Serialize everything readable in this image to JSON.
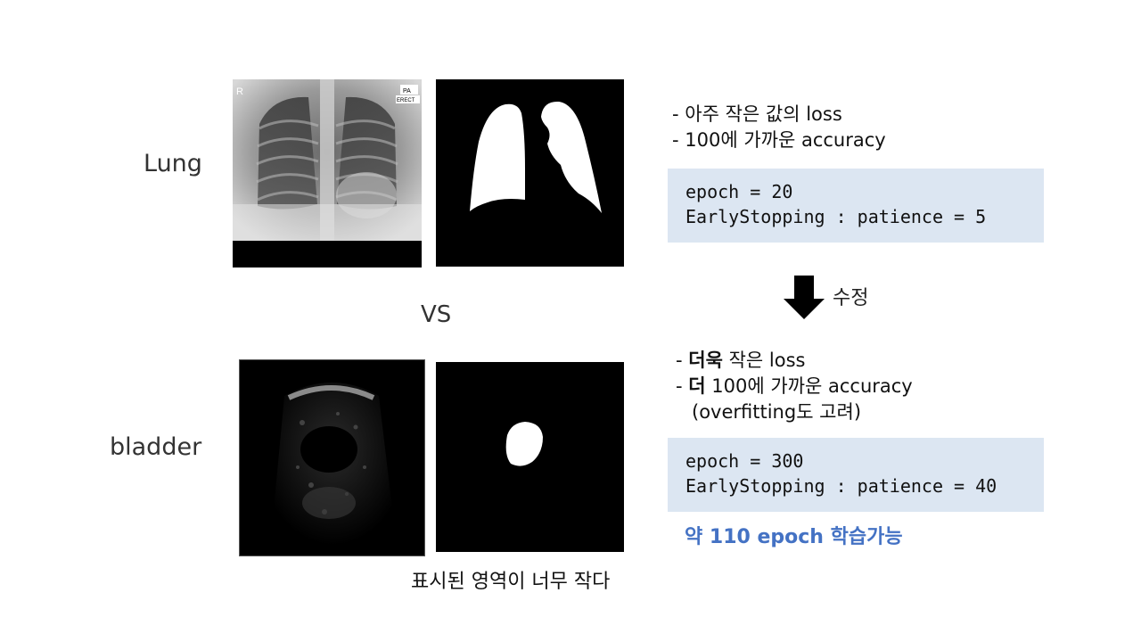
{
  "rows": {
    "lung_label": "Lung",
    "bladder_label": "bladder"
  },
  "xray": {
    "marker_r": "R",
    "marker_pa": "PA",
    "marker_erect": "ERECT"
  },
  "vs_label": "VS",
  "caption": "표시된 영역이 너무 작다",
  "before": {
    "bullet1": "- 아주 작은 값의 loss",
    "bullet2": "- 100에 가까운 accuracy",
    "code_line1": "epoch = 20",
    "code_line2": "EarlyStopping : patience = 5"
  },
  "arrow_label": "수정",
  "after": {
    "bullet1_prefix": "- ",
    "bullet1_bold": "더욱",
    "bullet1_rest": " 작은 loss",
    "bullet2_prefix": "- ",
    "bullet2_bold": "더",
    "bullet2_rest": " 100에 가까운 accuracy",
    "bullet3": "(overfitting도 고려)",
    "code_line1": "epoch = 300",
    "code_line2": "EarlyStopping : patience = 40",
    "note": "약 110 epoch 학습가능"
  }
}
